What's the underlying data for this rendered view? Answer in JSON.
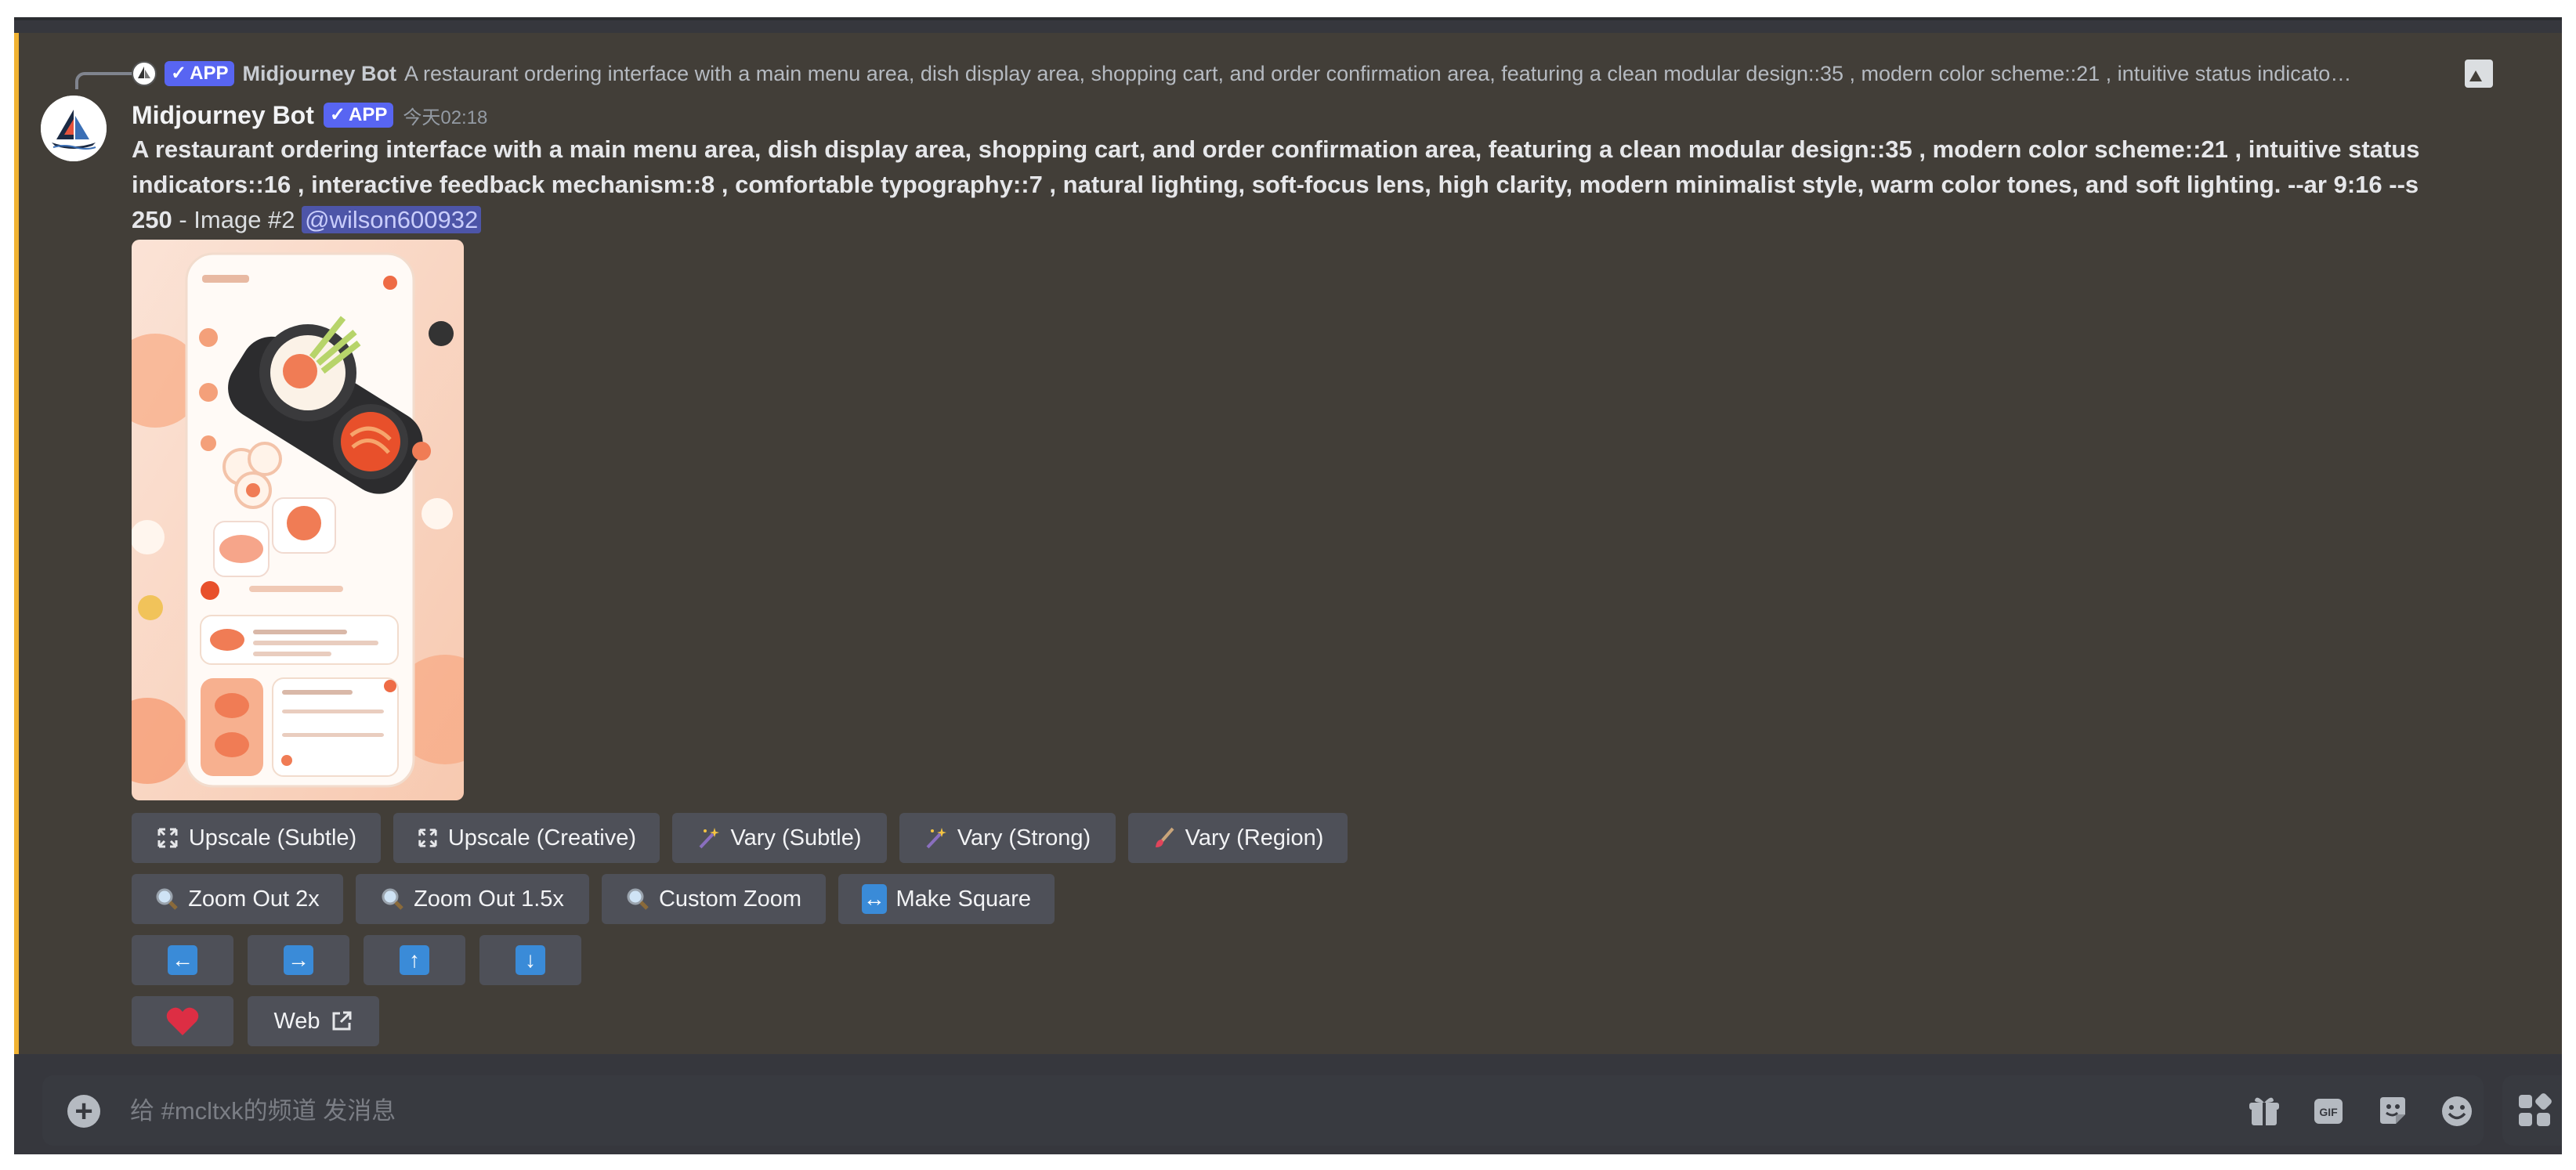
{
  "reply": {
    "badge": "APP",
    "author": "Midjourney Bot",
    "text": "A restaurant ordering interface with a main menu area, dish display area, shopping cart, and order confirmation area, featuring a clean modular design::35 , modern color scheme::21 , intuitive status indicato…"
  },
  "message": {
    "author": "Midjourney Bot",
    "badge": "APP",
    "timestamp": "今天02:18",
    "prompt": "A restaurant ordering interface with a main menu area, dish display area, shopping cart, and order confirmation area, featuring a clean modular design::35 , modern color scheme::21 , intuitive status indicators::16 , interactive feedback mechanism::8 , comfortable typography::7 , natural lighting, soft-focus lens, high clarity, modern minimalist style, warm color tones, and soft lighting. --ar 9:16 --s 250",
    "suffix": " - Image #2 ",
    "mention": "@wilson600932"
  },
  "buttons": {
    "row1": [
      "Upscale (Subtle)",
      "Upscale (Creative)",
      "Vary (Subtle)",
      "Vary (Strong)",
      "Vary (Region)"
    ],
    "row2": [
      "Zoom Out 2x",
      "Zoom Out 1.5x",
      "Custom Zoom",
      "Make Square"
    ],
    "row4_web": "Web"
  },
  "input": {
    "placeholder": "给 #mcltxk的频道 发消息"
  },
  "colors": {
    "background": "#423e38",
    "accent": "#f0b232",
    "button": "#4e5058",
    "app_badge": "#5865f2",
    "arrow": "#3a8bd8",
    "heart": "#dd2e44"
  },
  "icons": [
    "image-icon",
    "expand-icon",
    "sparkle-wand-icon",
    "paintbrush-icon",
    "magnifier-icon",
    "left-right-arrow-icon",
    "arrow-left-icon",
    "arrow-right-icon",
    "arrow-up-icon",
    "arrow-down-icon",
    "heart-icon",
    "external-link-icon",
    "plus-icon",
    "gift-icon",
    "gif-icon",
    "sticker-icon",
    "emoji-icon",
    "apps-icon"
  ]
}
